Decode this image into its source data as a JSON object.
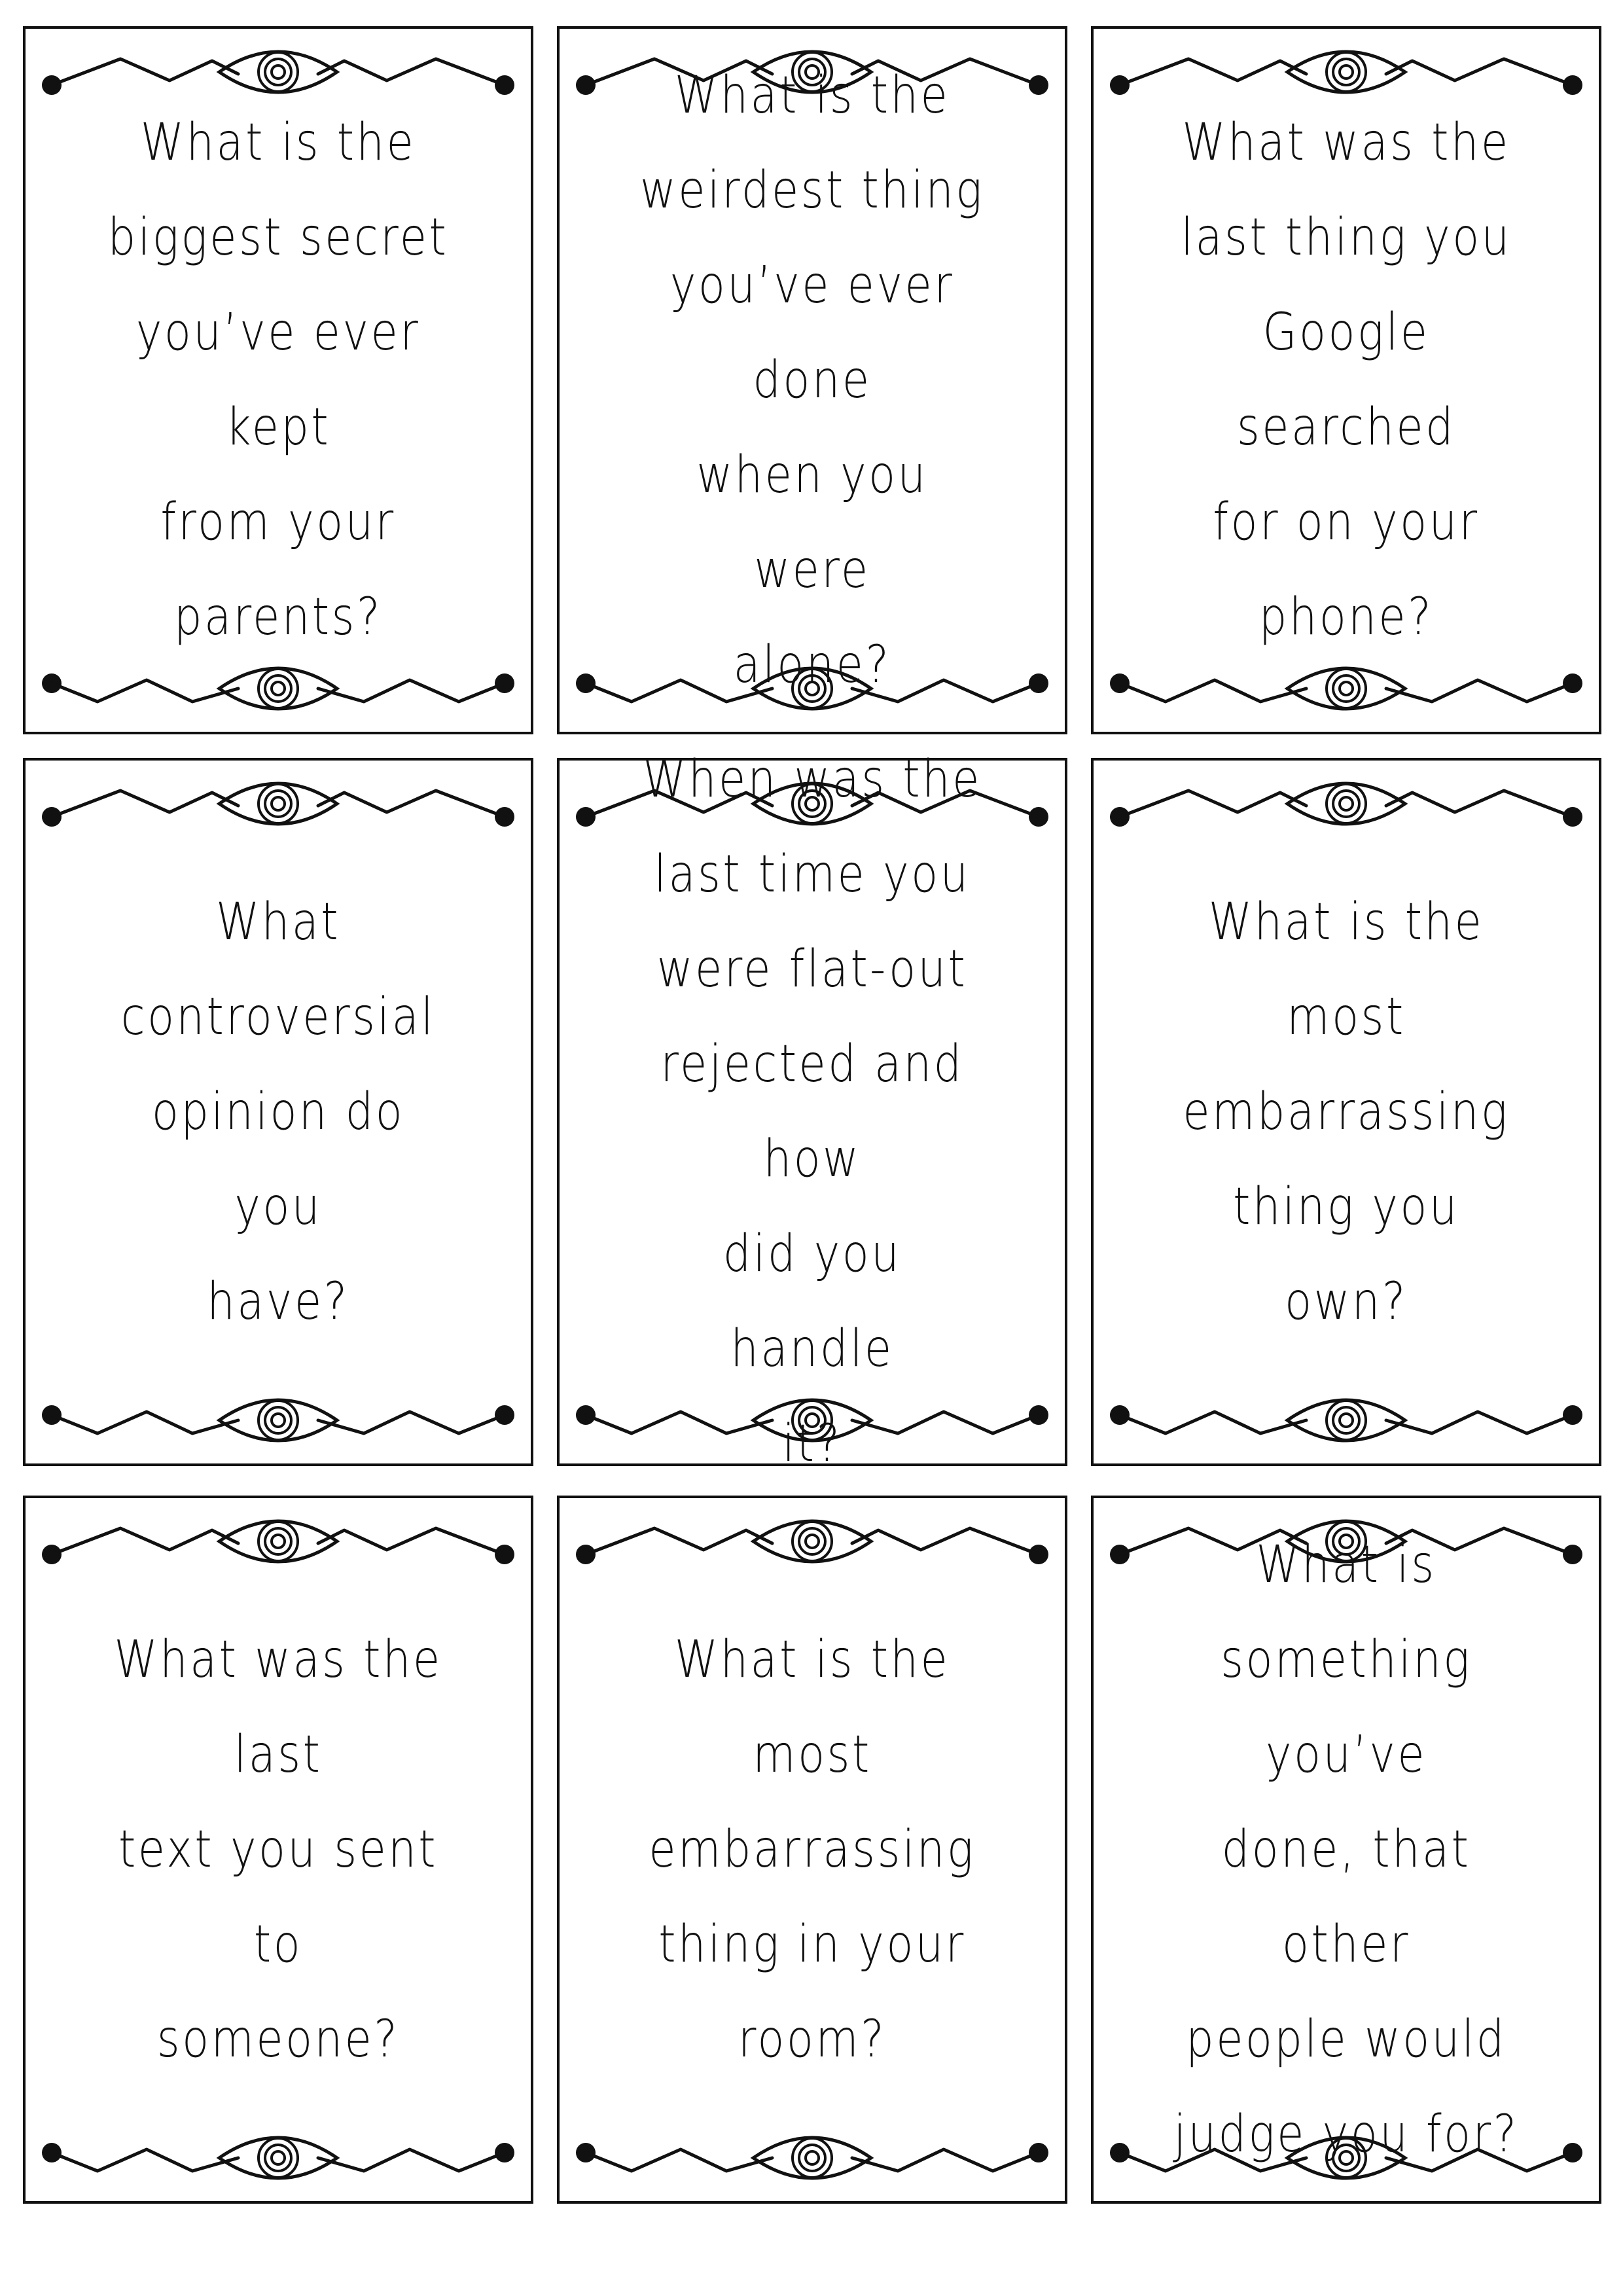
{
  "cards": [
    {
      "question": "What is the\nbiggest secret\nyou’ve ever kept\nfrom your\nparents?"
    },
    {
      "question": "What is the\nweirdest thing\nyou’ve ever done\nwhen you were\nalone?"
    },
    {
      "question": "What was the\nlast thing you\nGoogle searched\nfor on your\nphone?"
    },
    {
      "question": "What\ncontroversial\nopinion do you\nhave?"
    },
    {
      "question": "When was the\nlast time you\nwere flat-out\nrejected and how\ndid you handle\nit?"
    },
    {
      "question": "What is the most\nembarrassing\nthing you own?"
    },
    {
      "question": "What was the last\ntext you sent to\nsomeone?"
    },
    {
      "question": "What is the most\nembarrassing\nthing in your\nroom?"
    },
    {
      "question": "What is\nsomething you’ve\ndone, that other\npeople would\njudge you for?"
    }
  ],
  "ornament": {
    "icon": "eye-icon",
    "line_color": "#111111"
  }
}
